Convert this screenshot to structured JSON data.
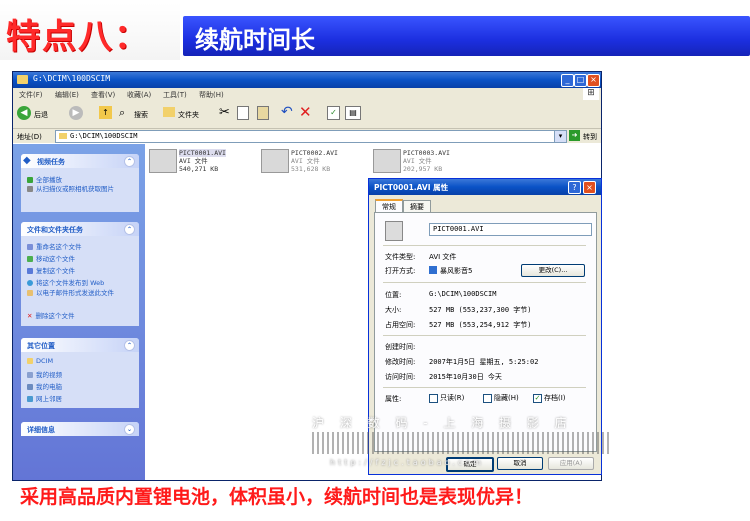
{
  "banner": {
    "badge": "特点八：",
    "title": "续航时间长"
  },
  "explorer": {
    "title": "G:\\DCIM\\100DSCIM",
    "menu": [
      "文件(F)",
      "编辑(E)",
      "查看(V)",
      "收藏(A)",
      "工具(T)",
      "帮助(H)"
    ],
    "toolbar": {
      "back": "后退",
      "search": "搜索",
      "folders": "文件夹"
    },
    "address_label": "地址(D)",
    "address_value": "G:\\DCIM\\100DSCIM",
    "go": "转到",
    "video_tasks": {
      "title": "视频任务",
      "items": [
        "全部播放",
        "从扫描仪或照相机获取图片"
      ]
    },
    "file_tasks": {
      "title": "文件和文件夹任务",
      "items": [
        "重命名这个文件",
        "移动这个文件",
        "复制这个文件",
        "将这个文件发布到 Web",
        "以电子邮件形式发送此文件",
        "删除这个文件"
      ]
    },
    "other_places": {
      "title": "其它位置",
      "items": [
        "DCIM",
        "我的视频",
        "我的电脑",
        "网上邻居"
      ]
    },
    "details": {
      "title": "详细信息"
    },
    "files": [
      {
        "name": "PICT0001.AVI",
        "type": "AVI 文件",
        "size": "540,271 KB"
      },
      {
        "name": "PICT0002.AVI",
        "type": "AVI 文件",
        "size": "531,628 KB"
      },
      {
        "name": "PICT0003.AVI",
        "type": "AVI 文件",
        "size": "202,957 KB"
      }
    ]
  },
  "dialog": {
    "title": "PICT0001.AVI 属性",
    "tabs": [
      "常规",
      "摘要"
    ],
    "filename": "PICT0001.AVI",
    "file_type_label": "文件类型:",
    "file_type": "AVI 文件",
    "open_with_label": "打开方式:",
    "open_with": "暴风影音5",
    "change": "更改(C)...",
    "location_label": "位置:",
    "location": "G:\\DCIM\\100DSCIM",
    "size_label": "大小:",
    "size": "527 MB (553,237,300 字节)",
    "disk_size_label": "占用空间:",
    "disk_size": "527 MB (553,254,912 字节)",
    "created_label": "创建时间:",
    "created": "",
    "modified_label": "修改时间:",
    "modified": "2007年1月5日 星期五, 5:25:02",
    "accessed_label": "访问时间:",
    "accessed": "2015年10月30日 今天",
    "attrs_label": "属性:",
    "readonly": "只读(R)",
    "hidden": "隐藏(H)",
    "archive": "存档(I)",
    "ok": "确定",
    "cancel": "取消",
    "apply": "应用(A)"
  },
  "watermark": {
    "line1": "沪 深 数 码 - 上 海 摄 影 店",
    "line2": "http://fzjc.taobao.com"
  },
  "slogan": "采用高品质内置锂电池，体积虽小，续航时间也是表现优异！"
}
